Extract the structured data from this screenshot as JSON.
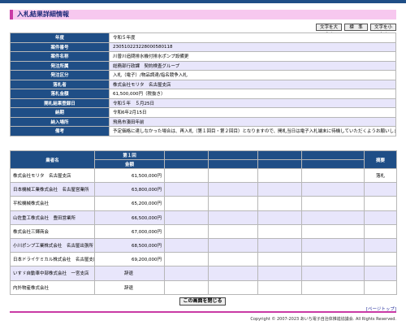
{
  "header": {
    "title": "入札結果詳細情報"
  },
  "font_controls": {
    "enlarge": "文字を大きく",
    "standard": "標　準",
    "shrink": "文字を小さく"
  },
  "info": [
    {
      "label": "年度",
      "value": "令和５年度"
    },
    {
      "label": "案件番号",
      "value": "230510223228000580118"
    },
    {
      "label": "案件名称",
      "value": "川曽川追問排水機付排水ポンプ設備更"
    },
    {
      "label": "発注所属",
      "value": "総務部行政課　契約検査グループ"
    },
    {
      "label": "発注区分",
      "value": "入札（電子）/物品調達/指名競争入札"
    },
    {
      "label": "落札者",
      "value": "株式会社モリタ　名古屋支店"
    },
    {
      "label": "落札金額",
      "value": "61,500,000円（税抜き）"
    },
    {
      "label": "開札結果登録日",
      "value": "令和５年　５月25日"
    },
    {
      "label": "納期",
      "value": "令和6年2月15日"
    },
    {
      "label": "納入場所",
      "value": "飛鳥市湊田年前"
    },
    {
      "label": "備考",
      "value": "予定価格に達しなかった場合は、再入札（第１回目・第２回目）となりますので、開札当日は電子入札端末に待機していただくようお願いします。"
    }
  ],
  "bids": {
    "header_bidder": "業者名",
    "header_round1": "第１回",
    "header_amount": "金額",
    "header_remarks": "摘要",
    "rows": [
      {
        "bidder": "株式会社モリタ　名古屋支店",
        "amount": "61,500,000円",
        "remark": "落札"
      },
      {
        "bidder": "日本機械工業株式会社　名古屋営業所",
        "amount": "63,800,000円",
        "remark": ""
      },
      {
        "bidder": "平松機械株式会社",
        "amount": "65,200,000円",
        "remark": ""
      },
      {
        "bidder": "山佐重工株式会社　豊田営業所",
        "amount": "66,500,000円",
        "remark": ""
      },
      {
        "bidder": "株式会社三輝商会",
        "amount": "67,000,000円",
        "remark": ""
      },
      {
        "bidder": "小川ポンプ工業株式会社　名古屋出張所",
        "amount": "68,500,000円",
        "remark": ""
      },
      {
        "bidder": "日本ドライケミカル株式会社　名古屋支店",
        "amount": "69,200,000円",
        "remark": ""
      },
      {
        "bidder": "いすゞ自動車中部株式会社　一宮支店",
        "amount": "辞退",
        "remark": ""
      },
      {
        "bidder": "内外物産株式会社",
        "amount": "辞退",
        "remark": ""
      }
    ]
  },
  "footer": {
    "close_button": "この画面を閉じる",
    "page_top": "[ページトップ]",
    "copyright": "Copyright © 2007-2023 あいち電子自治体推進協議会. All Rights Reserved."
  }
}
